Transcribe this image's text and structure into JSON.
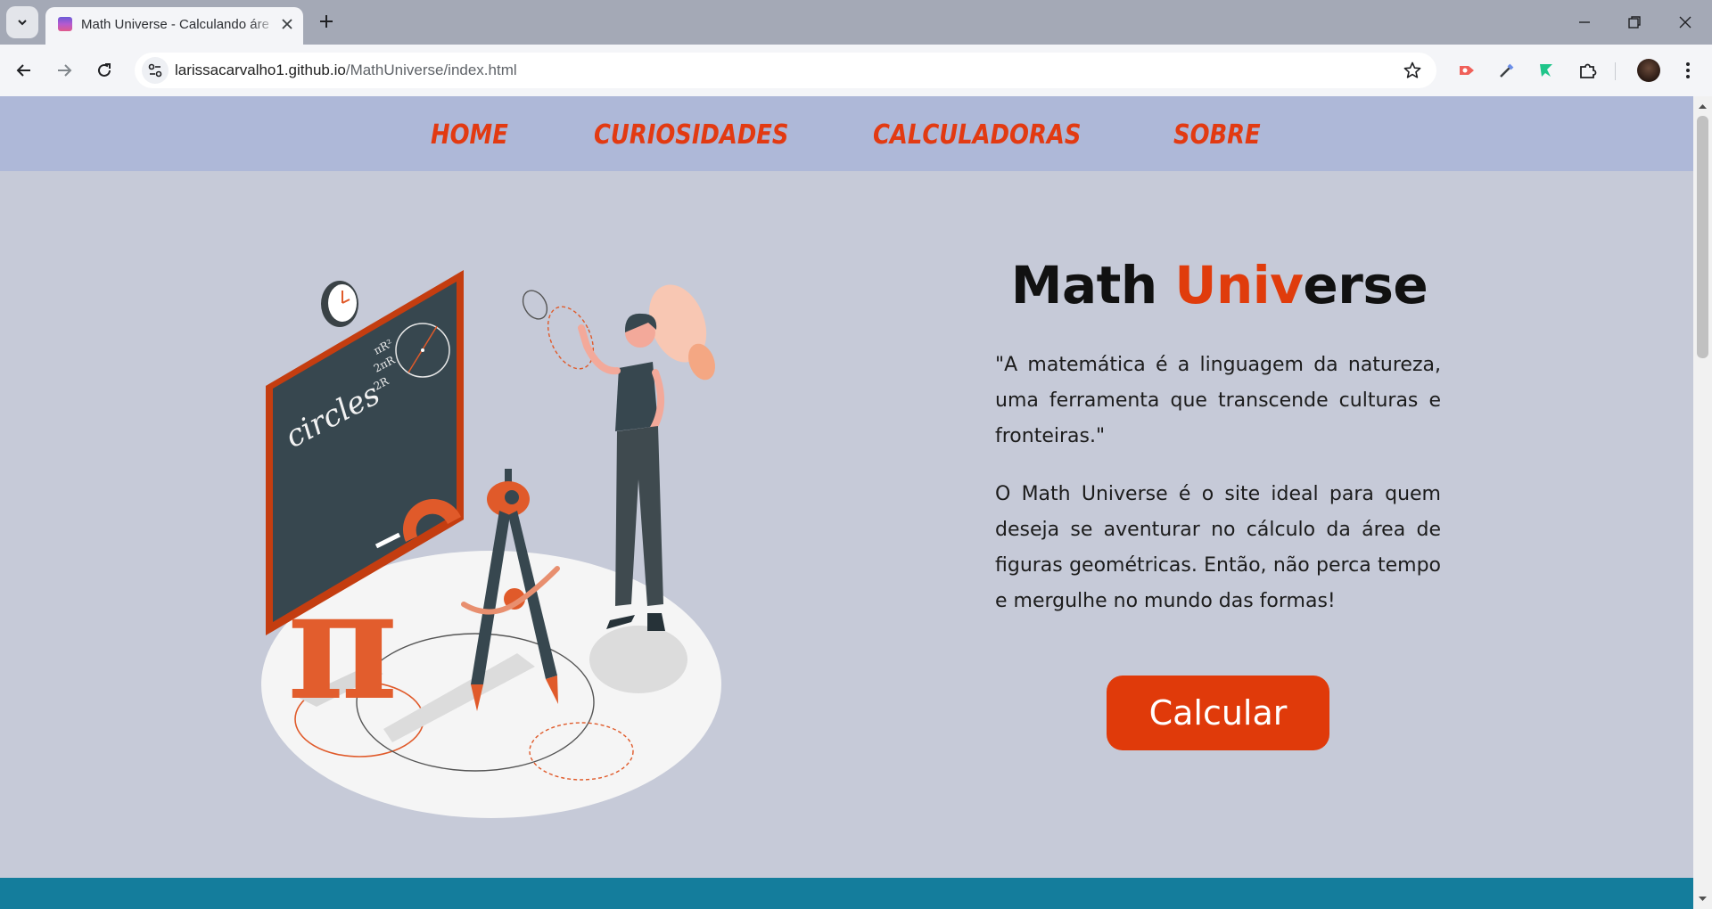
{
  "browser": {
    "tab_title": "Math Universe - Calculando área",
    "url_host": "larissacarvalho1.github.io",
    "url_path": "/MathUniverse/index.html"
  },
  "nav": {
    "items": [
      {
        "label": "HOME"
      },
      {
        "label": "CURIOSIDADES"
      },
      {
        "label": "CALCULADORAS"
      },
      {
        "label": "SOBRE"
      }
    ]
  },
  "hero": {
    "title_part1": "Math ",
    "title_accent": "Univ",
    "title_part2": "erse",
    "quote": "\"A matemática é a linguagem da natureza, uma ferramenta que transcende culturas e fronteiras.\"",
    "description": "O Math Universe é o site ideal para quem deseja se aventurar no cálculo da área de figuras geométricas. Então, não perca tempo e mergulhe no mundo das formas!",
    "button_label": "Calcular",
    "illustration": {
      "board_text": "circles",
      "formula_1": "πR²",
      "formula_2": "2πR",
      "formula_3": "2R",
      "pi_symbol": "π"
    }
  },
  "colors": {
    "accent": "#e03c0c",
    "nav_bg": "#aeb8d8",
    "page_bg": "#c6cad8",
    "footer": "#147d9c"
  }
}
